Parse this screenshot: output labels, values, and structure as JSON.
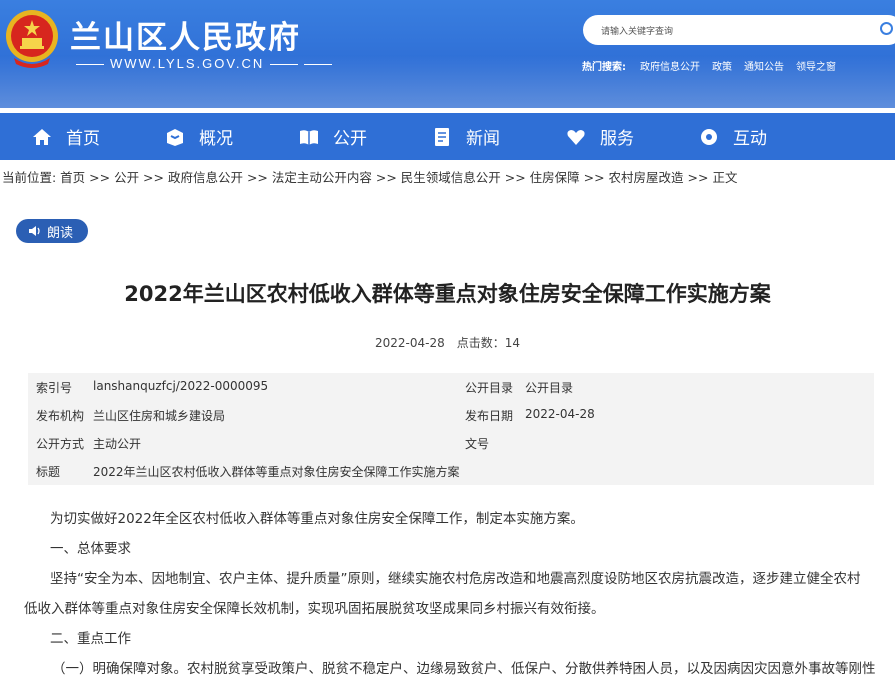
{
  "header": {
    "site_title": "兰山区人民政府",
    "site_url": "WWW.LYLS.GOV.CN",
    "search_placeholder": "请输入关键字查询",
    "hot_label": "热门搜索:",
    "hot_words": [
      "政府信息公开",
      "政策",
      "通知公告",
      "领导之窗"
    ]
  },
  "nav": {
    "items": [
      {
        "label": "首页",
        "icon": "home-icon"
      },
      {
        "label": "概况",
        "icon": "overview-icon"
      },
      {
        "label": "公开",
        "icon": "book-icon"
      },
      {
        "label": "新闻",
        "icon": "news-icon"
      },
      {
        "label": "服务",
        "icon": "heart-icon"
      },
      {
        "label": "互动",
        "icon": "chat-icon"
      }
    ]
  },
  "breadcrumb": "当前位置: 首页 >> 公开 >> 政府信息公开 >> 法定主动公开内容 >> 民生领域信息公开 >> 住房保障 >> 农村房屋改造 >> 正文",
  "read_button": "朗读",
  "article": {
    "title": "2022年兰山区农村低收入群体等重点对象住房安全保障工作实施方案",
    "date": "2022-04-28",
    "clicks": "点击数：14"
  },
  "info": {
    "index_label": "索引号",
    "index_value": "lanshanquzfcj/2022-0000095",
    "catalog_label": "公开目录",
    "catalog_value": "公开目录",
    "publisher_label": "发布机构",
    "publisher_value": "兰山区住房和城乡建设局",
    "pubdate_label": "发布日期",
    "pubdate_value": "2022-04-28",
    "mode_label": "公开方式",
    "mode_value": "主动公开",
    "docno_label": "文号",
    "docno_value": "",
    "subject_label": "标题",
    "subject_value": "2022年兰山区农村低收入群体等重点对象住房安全保障工作实施方案"
  },
  "body": {
    "p1": "为切实做好2022年全区农村低收入群体等重点对象住房安全保障工作，制定本实施方案。",
    "p2": "一、总体要求",
    "p3a": "坚持“安全为本、因地制宜、农户主体、提升质量”原则，继续实施农村危房改造和地震高烈度设防地区农房抗震改造，逐步建立健全农村",
    "p3b": "低收入群体等重点对象住房安全保障长效机制，实现巩固拓展脱贫攻坚成果同乡村振兴有效衔接。",
    "p4": "二、重点工作",
    "p5": "（一）明确保障对象。农村脱贫享受政策户、脱贫不稳定户、边缘易致贫户、低保户、分散供养特困人员，以及因病因灾因意外事故等刚性"
  },
  "colors": {
    "banner": "#3a7fe0",
    "nav": "#2f6fd6",
    "read_button": "#2b5fb4",
    "info_bg": "#f3f3f3"
  }
}
